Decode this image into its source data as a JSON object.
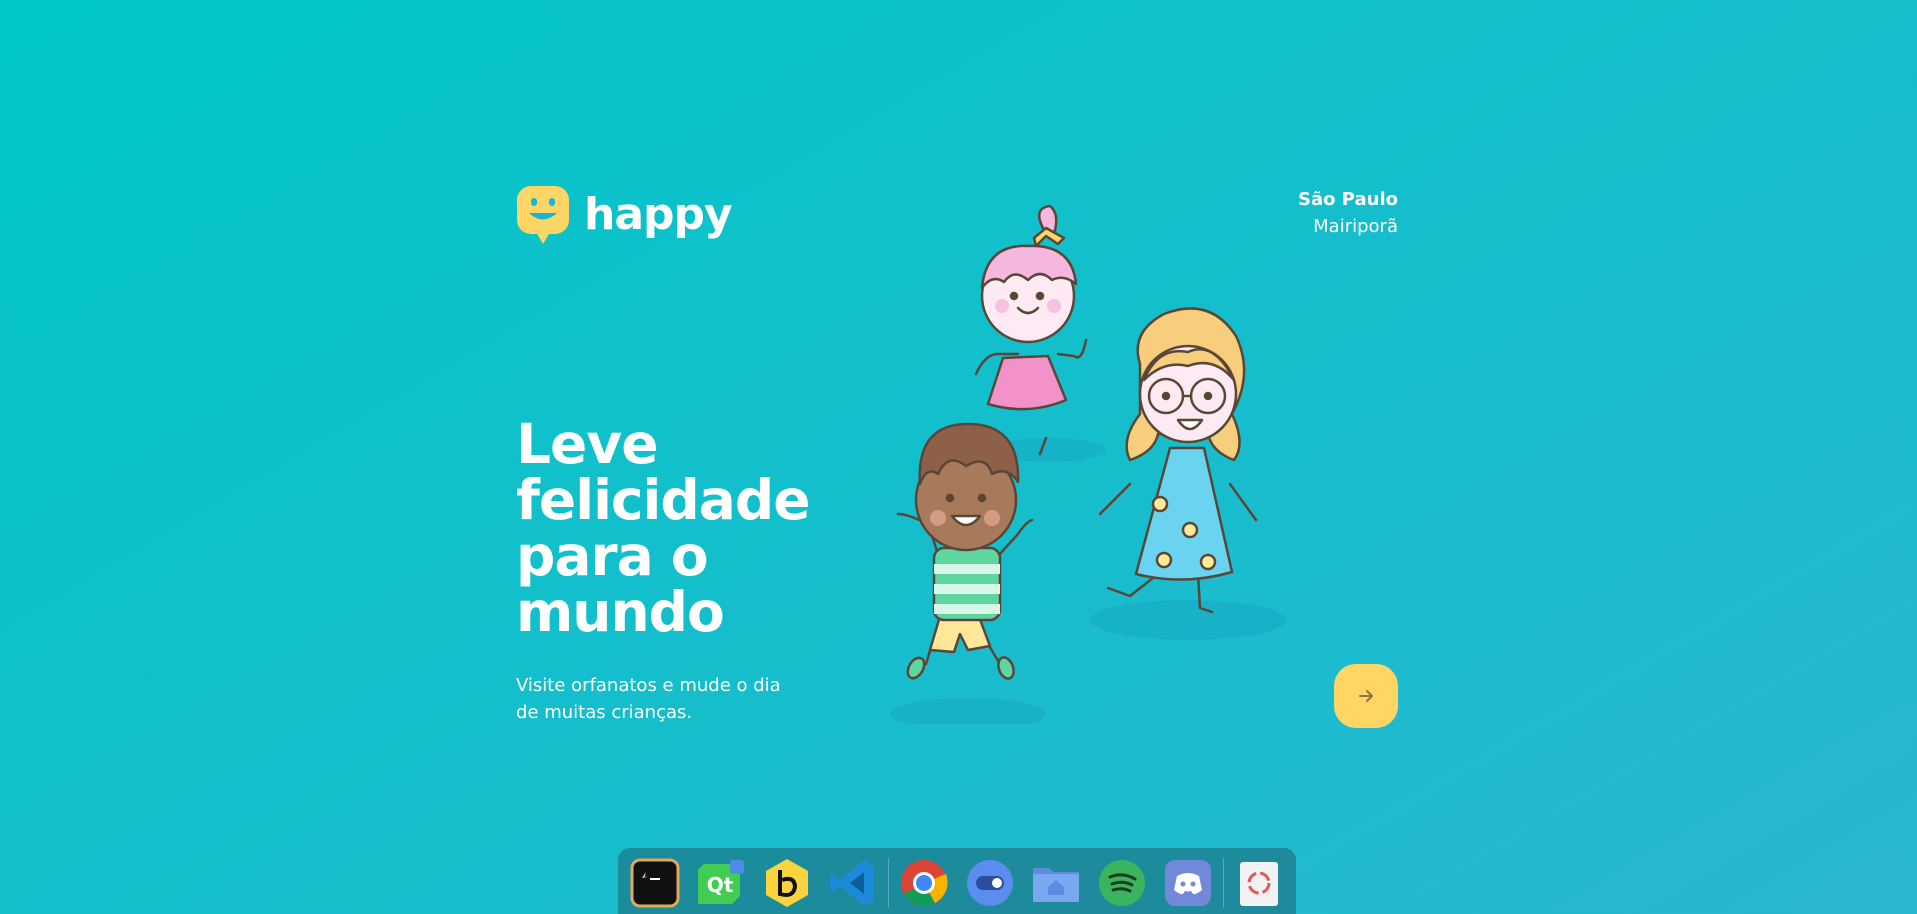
{
  "header": {
    "brand": "happy",
    "location": {
      "city": "São Paulo",
      "district": "Mairiporã"
    }
  },
  "hero": {
    "headline": "Leve felicidade para o mundo",
    "subtitle": "Visite orfanatos e mude o dia de muitas crianças."
  },
  "colors": {
    "background_start": "#00C7C7",
    "background_end": "#29B6D1",
    "accent_yellow": "#FFD666",
    "arrow": "#8D734B"
  },
  "enter_button": {
    "icon": "arrow-right-icon"
  },
  "dock": {
    "items": [
      {
        "name": "terminal",
        "icon": "terminal-icon"
      },
      {
        "name": "qt-creator",
        "icon": "qt-icon"
      },
      {
        "name": "beekeeper",
        "icon": "beekeeper-icon"
      },
      {
        "name": "vscode",
        "icon": "vscode-icon"
      },
      {
        "name": "chrome",
        "icon": "chrome-icon"
      },
      {
        "name": "toggle-app",
        "icon": "toggle-icon"
      },
      {
        "name": "files",
        "icon": "home-folder-icon"
      },
      {
        "name": "spotify",
        "icon": "spotify-icon"
      },
      {
        "name": "discord",
        "icon": "discord-icon"
      },
      {
        "name": "trash",
        "icon": "trash-icon"
      }
    ]
  }
}
